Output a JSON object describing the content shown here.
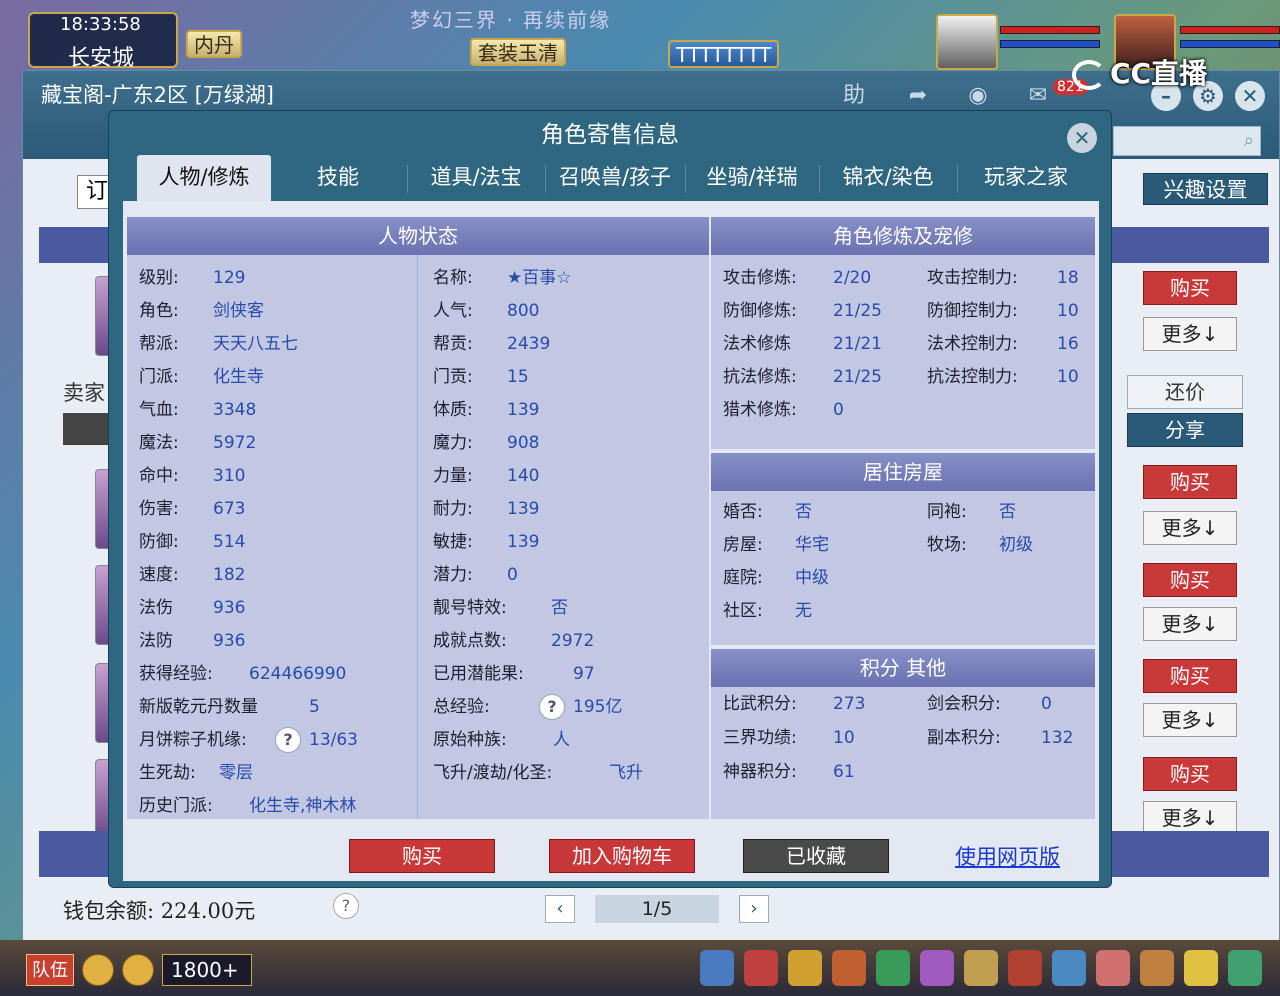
{
  "hud": {
    "time": "18:33:58",
    "city": "长安城",
    "inner_tag": "内丹",
    "banner": "梦幻三界 · 再续前缘",
    "suit_tag": "套装玉清",
    "name_tag": "TTTTTTTT",
    "stream_brand": "CC直播",
    "chat_count": "1800+",
    "team_label": "队伍"
  },
  "shop": {
    "title": "藏宝阁-广东2区 [万绿湖]",
    "helper_label": "助",
    "cart_badge": "821",
    "order_stub": "订",
    "interest_label": "兴趣设置",
    "seller_label": "卖家",
    "price_label": "还价",
    "share_label": "分享",
    "buy_label": "购买",
    "more_label": "更多↓",
    "wallet": "钱包余额: 224.00元",
    "pager": "1/5",
    "prev": "‹",
    "next": "›"
  },
  "modal": {
    "title": "角色寄售信息",
    "tabs": [
      "人物/修炼",
      "技能",
      "道具/法宝",
      "召唤兽/孩子",
      "坐骑/祥瑞",
      "锦衣/染色",
      "玩家之家"
    ],
    "status_title": "人物状态",
    "cultivation_title": "角色修炼及宠修",
    "house_title": "居住房屋",
    "points_title": "积分 其他",
    "status_left": [
      {
        "k": "级别:",
        "v": "129"
      },
      {
        "k": "角色:",
        "v": "剑侠客"
      },
      {
        "k": "帮派:",
        "v": "天天八五七"
      },
      {
        "k": "门派:",
        "v": "化生寺"
      },
      {
        "k": "气血:",
        "v": "3348"
      },
      {
        "k": "魔法:",
        "v": "5972"
      },
      {
        "k": "命中:",
        "v": "310"
      },
      {
        "k": "伤害:",
        "v": "673"
      },
      {
        "k": "防御:",
        "v": "514"
      },
      {
        "k": "速度:",
        "v": "182"
      },
      {
        "k": "法伤",
        "v": "936"
      },
      {
        "k": "法防",
        "v": "936"
      },
      {
        "k": "获得经验:",
        "v": "624466990"
      },
      {
        "k": "新版乾元丹数量",
        "v": "5"
      },
      {
        "k": "月饼粽子机缘:",
        "v": "13/63"
      },
      {
        "k": "生死劫:",
        "v": "零层"
      },
      {
        "k": "历史门派:",
        "v": "化生寺,神木林"
      }
    ],
    "status_right": [
      {
        "k": "名称:",
        "v": "★百事☆"
      },
      {
        "k": "人气:",
        "v": "800"
      },
      {
        "k": "帮贡:",
        "v": "2439"
      },
      {
        "k": "门贡:",
        "v": "15"
      },
      {
        "k": "体质:",
        "v": "139"
      },
      {
        "k": "魔力:",
        "v": "908"
      },
      {
        "k": "力量:",
        "v": "140"
      },
      {
        "k": "耐力:",
        "v": "139"
      },
      {
        "k": "敏捷:",
        "v": "139"
      },
      {
        "k": "潜力:",
        "v": "0"
      },
      {
        "k": "靓号特效:",
        "v": "否"
      },
      {
        "k": "成就点数:",
        "v": "2972"
      },
      {
        "k": "已用潜能果:",
        "v": "97"
      },
      {
        "k": "总经验:",
        "v": "195亿"
      },
      {
        "k": "原始种族:",
        "v": "人"
      },
      {
        "k": "飞升/渡劫/化圣:",
        "v": "飞升"
      }
    ],
    "cultivation_left": [
      {
        "k": "攻击修炼:",
        "v": "2/20"
      },
      {
        "k": "防御修炼:",
        "v": "21/25"
      },
      {
        "k": "法术修炼",
        "v": "21/21"
      },
      {
        "k": "抗法修炼:",
        "v": "21/25"
      },
      {
        "k": "猎术修炼:",
        "v": "0"
      }
    ],
    "cultivation_right": [
      {
        "k": "攻击控制力:",
        "v": "18"
      },
      {
        "k": "防御控制力:",
        "v": "10"
      },
      {
        "k": "法术控制力:",
        "v": "16"
      },
      {
        "k": "抗法控制力:",
        "v": "10"
      }
    ],
    "house_left": [
      {
        "k": "婚否:",
        "v": "否"
      },
      {
        "k": "房屋:",
        "v": "华宅"
      },
      {
        "k": "庭院:",
        "v": "中级"
      },
      {
        "k": "社区:",
        "v": "无"
      }
    ],
    "house_right": [
      {
        "k": "同袍:",
        "v": "否"
      },
      {
        "k": "牧场:",
        "v": "初级"
      }
    ],
    "points_left": [
      {
        "k": "比武积分:",
        "v": "273"
      },
      {
        "k": "三界功绩:",
        "v": "10"
      },
      {
        "k": "神器积分:",
        "v": "61"
      }
    ],
    "points_right": [
      {
        "k": "剑会积分:",
        "v": "0"
      },
      {
        "k": "副本积分:",
        "v": "132"
      }
    ],
    "buy_button": "购买",
    "cart_button": "加入购物车",
    "fav_button": "已收藏",
    "web_link": "使用网页版",
    "help_glyph": "?"
  },
  "colors": {
    "modal_bg": "#2f6680",
    "panel_head": "#7a82bc",
    "buy_red": "#c83838",
    "value_blue": "#2a4aa8"
  }
}
